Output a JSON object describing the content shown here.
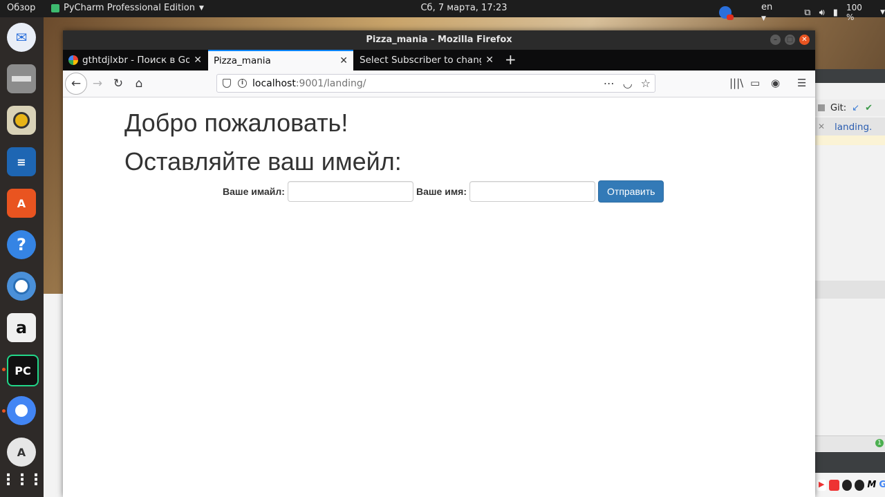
{
  "topbar": {
    "overview": "Обзор",
    "app_name": "PyCharm Professional Edition",
    "clock": "Сб, 7 марта, 17:23",
    "keyboard_layout": "en",
    "battery": "100 %"
  },
  "dock": {
    "items": [
      "thunderbird-icon",
      "files-icon",
      "rhythmbox-icon",
      "writer-icon",
      "software-center-icon",
      "help-icon",
      "chromium-icon",
      "amazon-icon",
      "pycharm-icon",
      "chrome-icon",
      "update-icon",
      "app-grid-icon"
    ]
  },
  "firefox": {
    "window_title": "Pizza_mania - Mozilla Firefox",
    "tabs": [
      {
        "label": "gthtdjlxbr - Поиск в Goo",
        "icon": "google-icon"
      },
      {
        "label": "Pizza_mania",
        "active": true
      },
      {
        "label": "Select Subscriber to change"
      }
    ],
    "url": {
      "host": "localhost",
      "path": ":9001/landing/"
    },
    "accent": "#0a84ff"
  },
  "page": {
    "welcome_heading": "Добро пожаловать!",
    "subscribe_heading": "Оставляйте ваш имейл:",
    "email_label": "Ваше имайл:",
    "email_value": "",
    "name_label": "Ваше имя:",
    "name_value": "",
    "submit_label": "Отправить",
    "button_color": "#337ab7"
  },
  "pycharm": {
    "git_label": "Git:",
    "tab_label": "landing.",
    "badge": "1"
  }
}
